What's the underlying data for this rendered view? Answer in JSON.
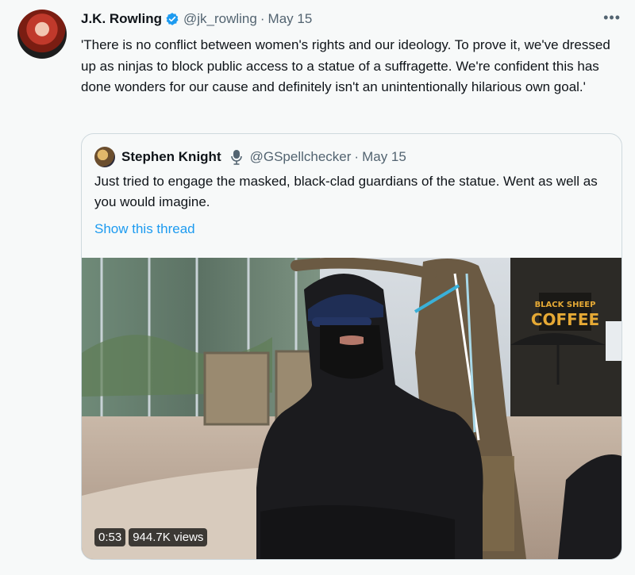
{
  "tweet": {
    "author_name": "J.K. Rowling",
    "handle": "@jk_rowling",
    "separator": "·",
    "date": "May 15",
    "more_label": "•••",
    "text": "'There is no conflict between women's rights and our ideology. To prove it, we've dressed up as ninjas to block public access to a statue of a suffragette. We're confident this has done wonders for our cause and definitely isn't an unintentionally hilarious own goal.'"
  },
  "quote": {
    "author_name": "Stephen Knight",
    "handle": "@GSpellchecker",
    "separator": "·",
    "date": "May 15",
    "text": "Just tried to engage the masked, black-clad guardians of the statue. Went as well as you would imagine.",
    "show_thread": "Show this thread",
    "video": {
      "duration": "0:53",
      "views": "944.7K views",
      "cafe_sign_line1": "BLACK SHEEP",
      "cafe_sign_line2": "COFFEE"
    }
  },
  "colors": {
    "accent": "#1d9bf0",
    "muted": "#536471",
    "text": "#0f1419",
    "background": "#f7f9f9",
    "border": "#cfd9de"
  },
  "icons": {
    "verified": "verified-badge-icon",
    "microphone": "microphone-icon",
    "more": "more-options-icon"
  }
}
